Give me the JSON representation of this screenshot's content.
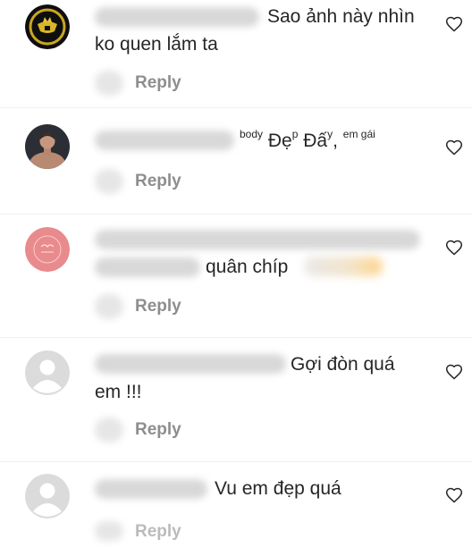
{
  "comments": [
    {
      "text_before": "Sao ảnh này nhìn ko quen lắm ta",
      "reply_label": "Reply"
    },
    {
      "segments": [
        "body",
        "Đẹ",
        "p",
        "Đấ",
        "y",
        ", ",
        "em gái"
      ],
      "reply_label": "Reply"
    },
    {
      "text": "quân chíp",
      "reply_label": "Reply"
    },
    {
      "text": "Gợi đòn quá em !!!",
      "reply_label": "Reply"
    },
    {
      "text_a": "Vu",
      "text_b": " em đẹp quá",
      "reply_label": "Reply"
    }
  ],
  "icons": {
    "like": "heart-outline-icon",
    "default_avatar": "person-placeholder-icon"
  },
  "colors": {
    "text": "#262626",
    "secondary": "#8e8e8e",
    "avatar_gray": "#dbdbdb",
    "avatar_pink": "#e8898c"
  }
}
